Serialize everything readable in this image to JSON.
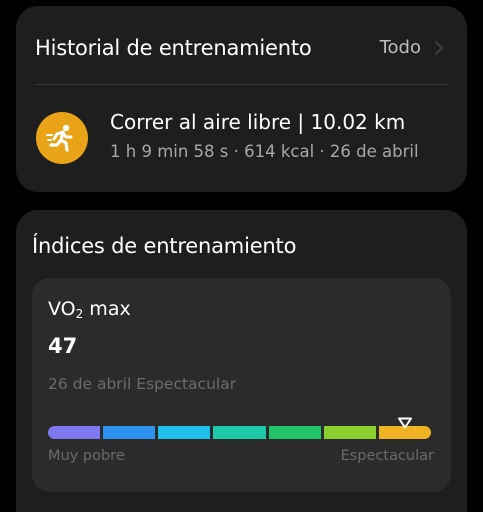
{
  "history": {
    "title": "Historial de entrenamiento",
    "view_all_label": "Todo",
    "workout": {
      "title": "Correr al aire libre | 10.02 km",
      "meta": "1 h 9 min 58 s · 614 kcal · 26 de abril",
      "icon": "running-icon",
      "icon_color": "#e8a317"
    }
  },
  "indices": {
    "title": "Índices de entrenamiento",
    "vo2": {
      "label_main": "VO",
      "label_sub": "2",
      "label_tail": " max",
      "value": "47",
      "date_rating": "26 de abril Espectacular",
      "scale_min_label": "Muy pobre",
      "scale_max_label": "Espectacular",
      "active_segment_index": 6,
      "segment_colors": [
        "#7f77f0",
        "#2e92f0",
        "#1ebfe8",
        "#1ec9a9",
        "#22c46a",
        "#8bcf2f",
        "#f0b321"
      ]
    }
  }
}
